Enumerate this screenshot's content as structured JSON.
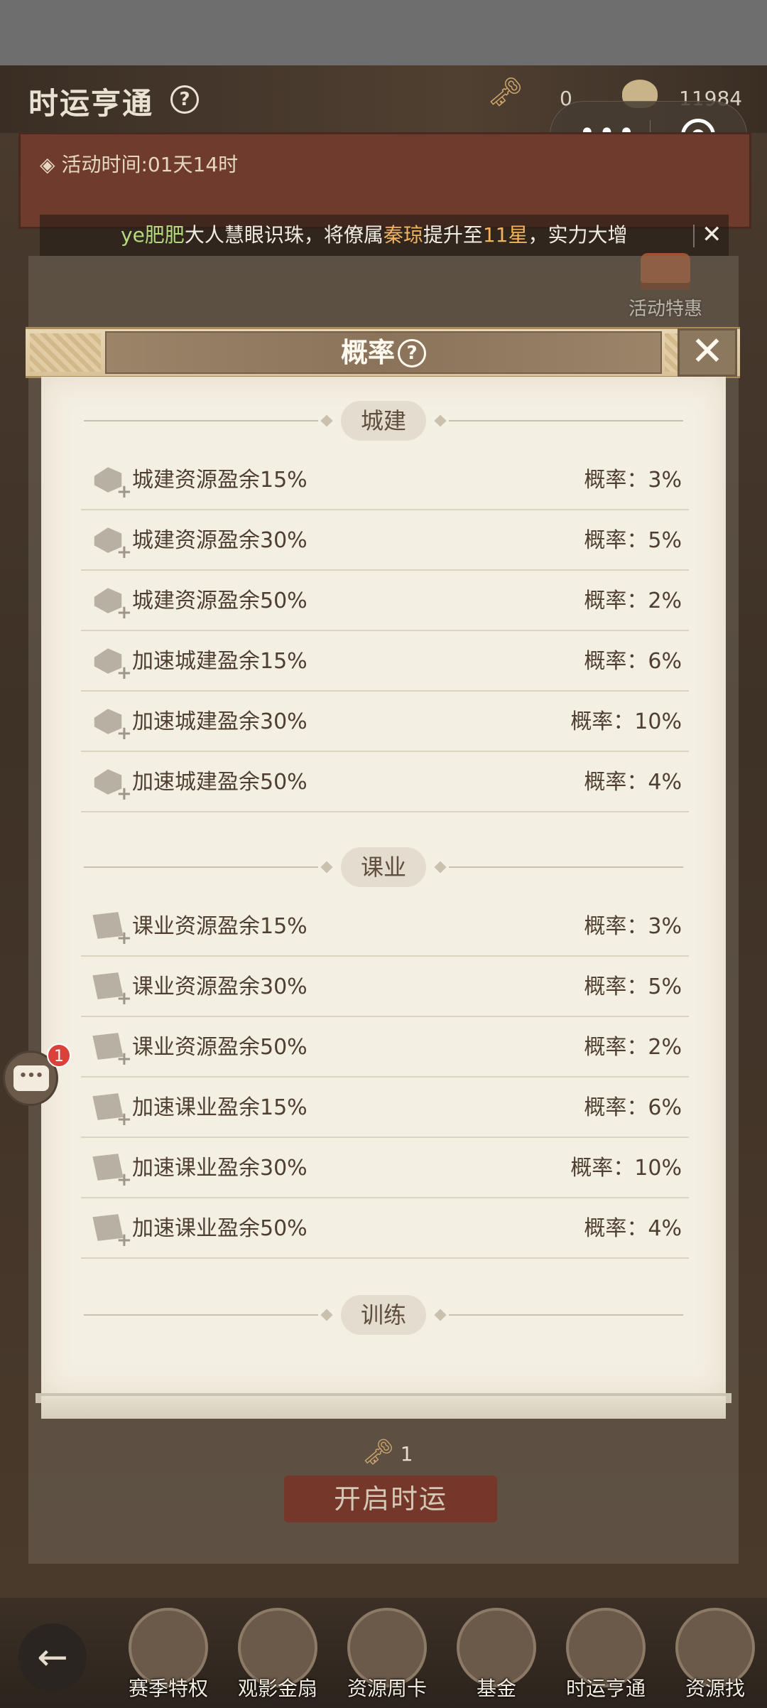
{
  "header": {
    "title": "时运亨通",
    "help_glyph": "?",
    "key_count": "0",
    "coin_count": "11984",
    "activity_time_label": "活动时间:",
    "activity_time_value": "01天14时"
  },
  "mini_program": {
    "more_glyph": "•••",
    "close_icon": "target-icon"
  },
  "marquee": {
    "player": "ye肥肥",
    "text1": "大人慧眼识珠，将僚属",
    "hero": "秦琼",
    "text2": "提升至",
    "stars": "11星",
    "text3": "，实力大增",
    "close_glyph": "✕"
  },
  "promo": {
    "label": "活动特惠"
  },
  "dialog": {
    "title": "概率",
    "help_glyph": "?",
    "close_glyph": "✕",
    "sections": [
      {
        "name": "城建",
        "icon": "building-icon",
        "rows": [
          {
            "name": "城建资源盈余15%",
            "prob": "概率：3%"
          },
          {
            "name": "城建资源盈余30%",
            "prob": "概率：5%"
          },
          {
            "name": "城建资源盈余50%",
            "prob": "概率：2%"
          },
          {
            "name": "加速城建盈余15%",
            "prob": "概率：6%"
          },
          {
            "name": "加速城建盈余30%",
            "prob": "概率：10%"
          },
          {
            "name": "加速城建盈余50%",
            "prob": "概率：4%"
          }
        ]
      },
      {
        "name": "课业",
        "icon": "scroll-icon",
        "rows": [
          {
            "name": "课业资源盈余15%",
            "prob": "概率：3%"
          },
          {
            "name": "课业资源盈余30%",
            "prob": "概率：5%"
          },
          {
            "name": "课业资源盈余50%",
            "prob": "概率：2%"
          },
          {
            "name": "加速课业盈余15%",
            "prob": "概率：6%"
          },
          {
            "name": "加速课业盈余30%",
            "prob": "概率：10%"
          },
          {
            "name": "加速课业盈余50%",
            "prob": "概率：4%"
          }
        ]
      },
      {
        "name": "训练",
        "rows": []
      }
    ]
  },
  "bottom": {
    "key_cost": "1",
    "start_button": "开启时运"
  },
  "nav": {
    "back_glyph": "←",
    "items": [
      {
        "label": "赛季特权"
      },
      {
        "label": "观影金扇"
      },
      {
        "label": "资源周卡"
      },
      {
        "label": "基金"
      },
      {
        "label": "时运亨通"
      },
      {
        "label": "资源找"
      }
    ]
  },
  "chat": {
    "badge": "1",
    "glyph": "•••"
  }
}
